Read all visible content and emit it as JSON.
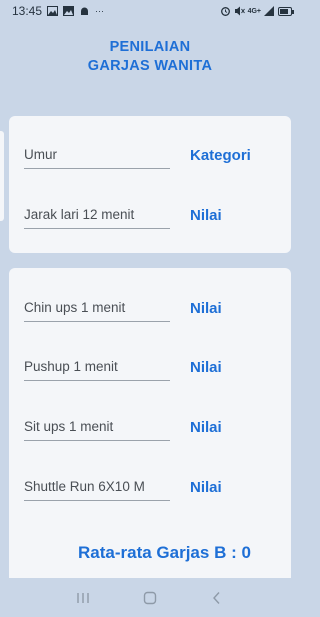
{
  "status_bar": {
    "time": "13:45",
    "network": "4G+",
    "more": "···",
    "icons": [
      "image-icon",
      "photo-icon",
      "android-icon",
      "alarm-icon",
      "mute-icon",
      "signal-icon",
      "battery-icon"
    ]
  },
  "header": {
    "title_line1": "PENILAIAN",
    "title_line2": "GARJAS WANITA"
  },
  "card1": {
    "fields": [
      {
        "label": "Umur",
        "result": "Kategori"
      },
      {
        "label": "Jarak lari 12 menit",
        "result": "Nilai"
      }
    ]
  },
  "card2": {
    "fields": [
      {
        "label": "Chin ups 1 menit",
        "result": "Nilai"
      },
      {
        "label": "Pushup 1 menit",
        "result": "Nilai"
      },
      {
        "label": "Sit ups 1 menit",
        "result": "Nilai"
      },
      {
        "label": "Shuttle Run 6X10 M",
        "result": "Nilai"
      }
    ],
    "summary": "Rata-rata Garjas B : 0"
  },
  "colors": {
    "background": "#c9d6e7",
    "accent": "#1e6fd6",
    "card": "#f4f6f9"
  }
}
